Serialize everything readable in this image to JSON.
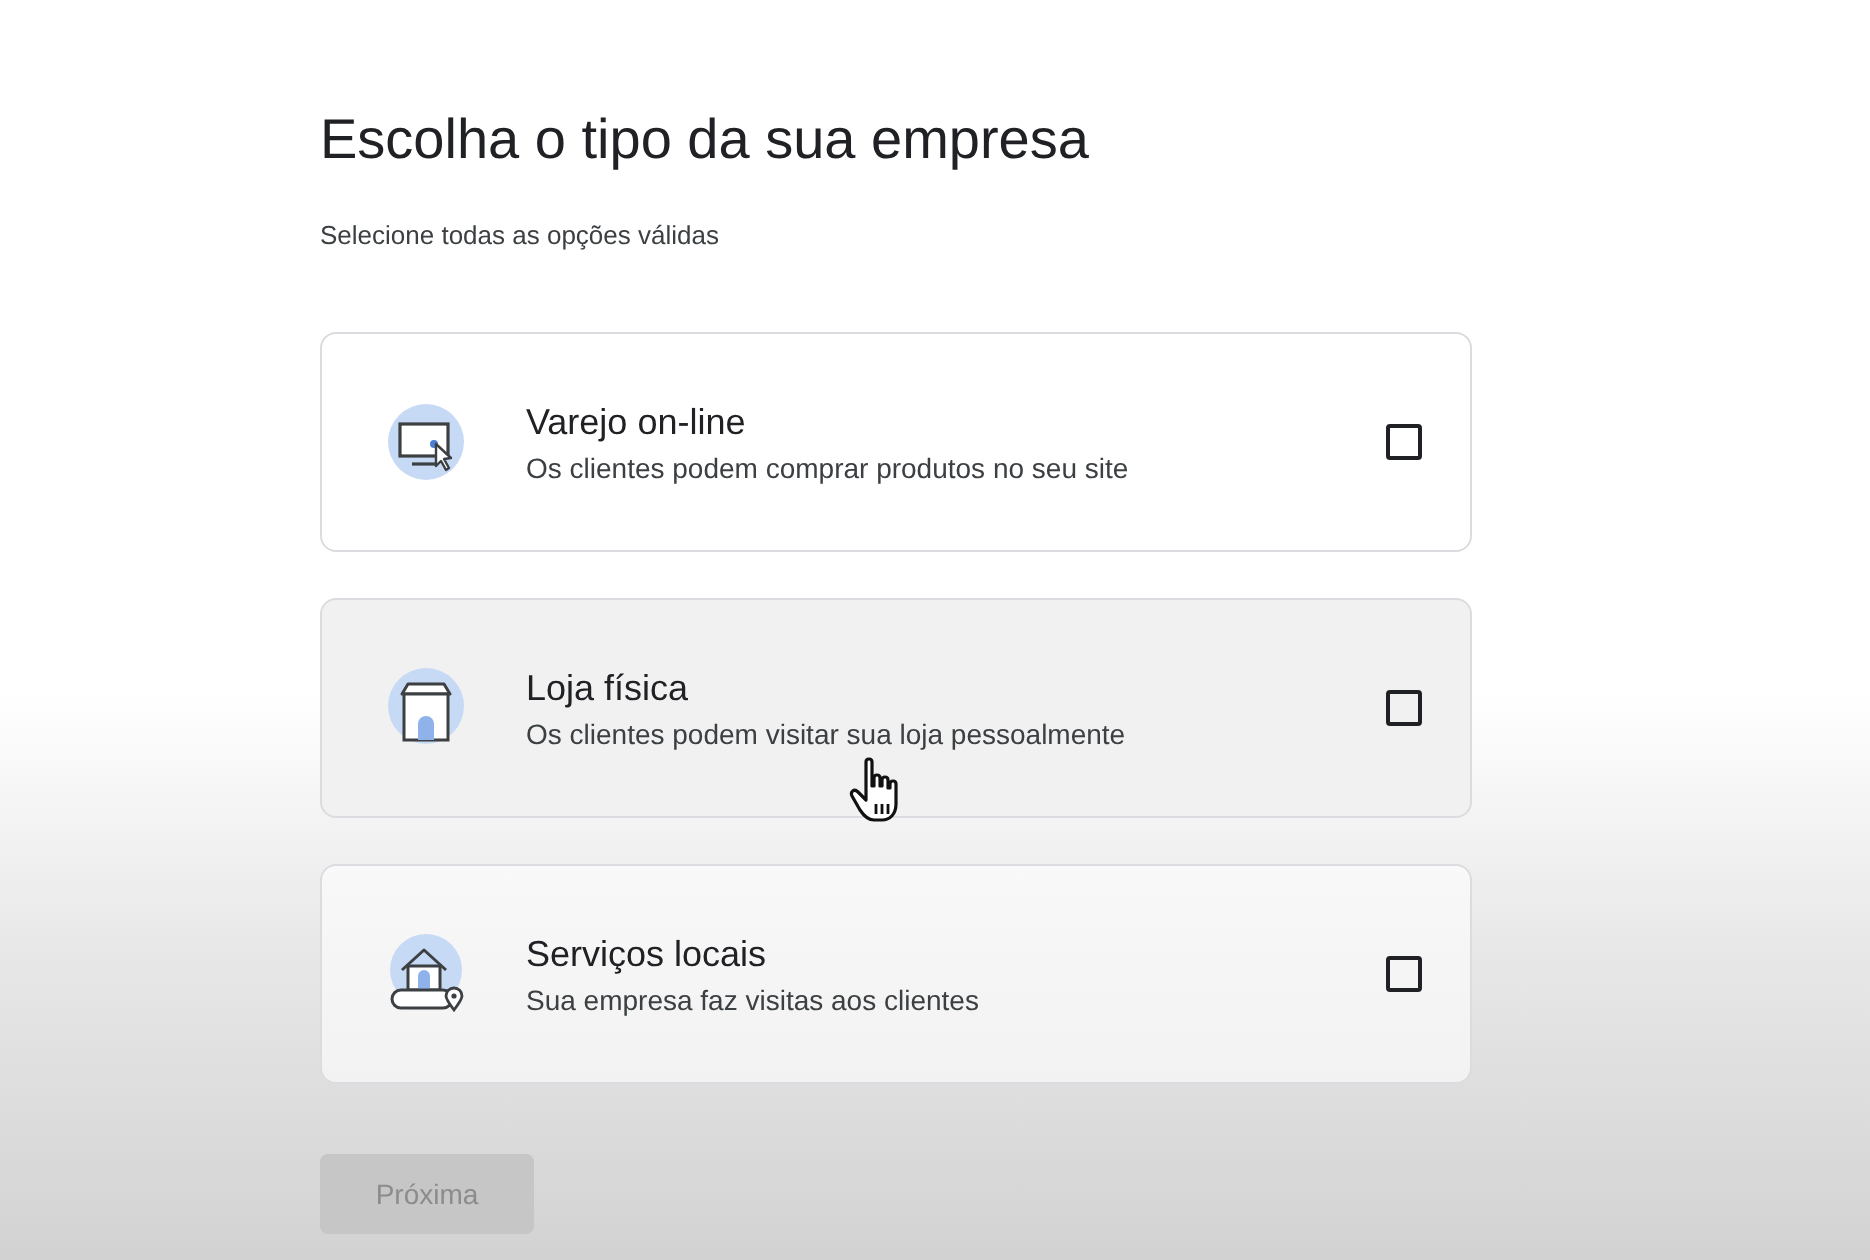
{
  "header": {
    "title": "Escolha o tipo da sua empresa",
    "subtitle": "Selecione todas as opções válidas"
  },
  "options": [
    {
      "kind": "online",
      "title": "Varejo on-line",
      "description": "Os clientes podem comprar produtos no seu site",
      "checked": false,
      "hovered": false
    },
    {
      "kind": "store",
      "title": "Loja física",
      "description": "Os clientes podem visitar sua loja pessoalmente",
      "checked": false,
      "hovered": true
    },
    {
      "kind": "service",
      "title": "Serviços locais",
      "description": "Sua empresa faz visitas aos clientes",
      "checked": false,
      "hovered": false
    }
  ],
  "next_button": {
    "label": "Próxima",
    "disabled": true
  }
}
